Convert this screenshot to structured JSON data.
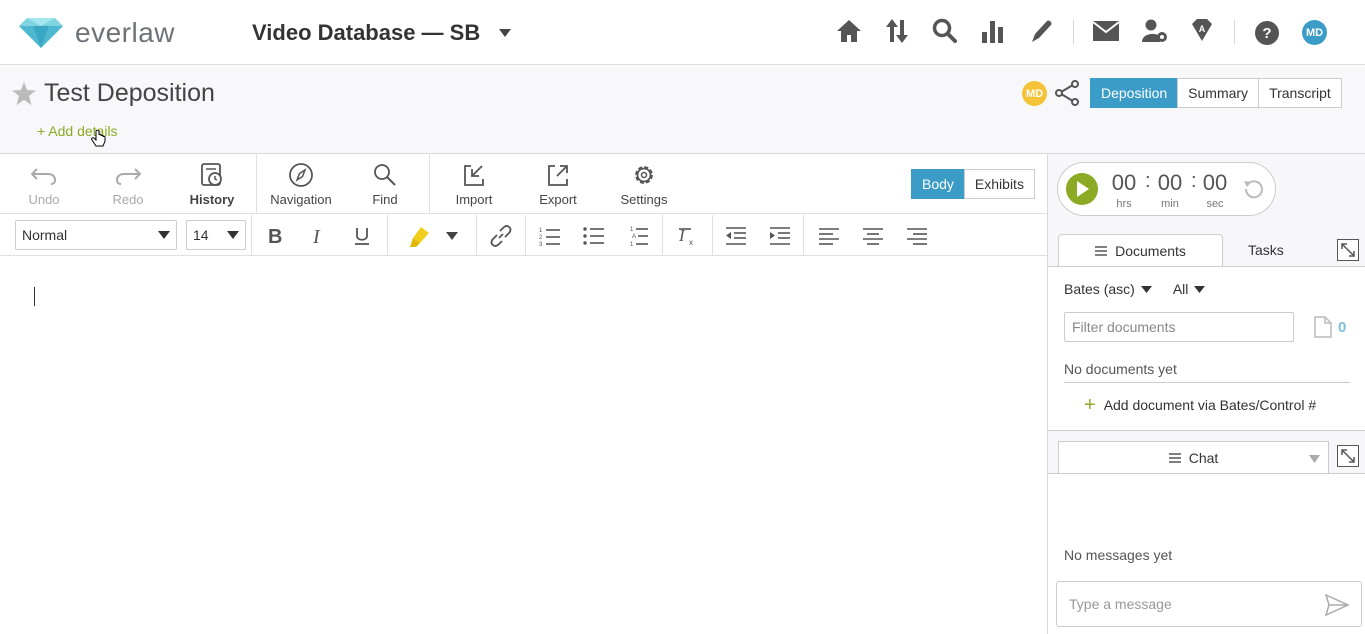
{
  "app": {
    "logo_text": "everlaw",
    "database_title": "Video Database — SB"
  },
  "header": {
    "icons": [
      "home-icon",
      "sort-arrows-icon",
      "search-icon",
      "bar-chart-icon",
      "pen-icon",
      "mail-icon",
      "user-gear-icon",
      "admin-gem-icon",
      "help-icon"
    ],
    "user_initials": "MD"
  },
  "page": {
    "title": "Test Deposition",
    "add_details": "+ Add details",
    "collaborator_initials": "MD",
    "view_tabs": [
      "Deposition",
      "Summary",
      "Transcript"
    ],
    "active_view_tab": "Deposition"
  },
  "toolbar": {
    "undo": "Undo",
    "redo": "Redo",
    "history": "History",
    "navigation": "Navigation",
    "find": "Find",
    "import": "Import",
    "export": "Export",
    "settings": "Settings",
    "body": "Body",
    "exhibits": "Exhibits"
  },
  "format": {
    "style": "Normal",
    "size": "14"
  },
  "timer": {
    "hrs": "00",
    "min": "00",
    "sec": "00",
    "hrs_label": "hrs",
    "min_label": "min",
    "sec_label": "sec"
  },
  "documents": {
    "tab_label": "Documents",
    "tasks_label": "Tasks",
    "sort": "Bates (asc)",
    "scope": "All",
    "filter_placeholder": "Filter documents",
    "count": "0",
    "empty": "No documents yet",
    "add_label": "Add document via Bates/Control #"
  },
  "chat": {
    "tab_label": "Chat",
    "empty": "No messages yet",
    "input_placeholder": "Type a message"
  },
  "colors": {
    "accent": "#3a9cc7",
    "green": "#8caa23",
    "badge": "#f5c338"
  }
}
